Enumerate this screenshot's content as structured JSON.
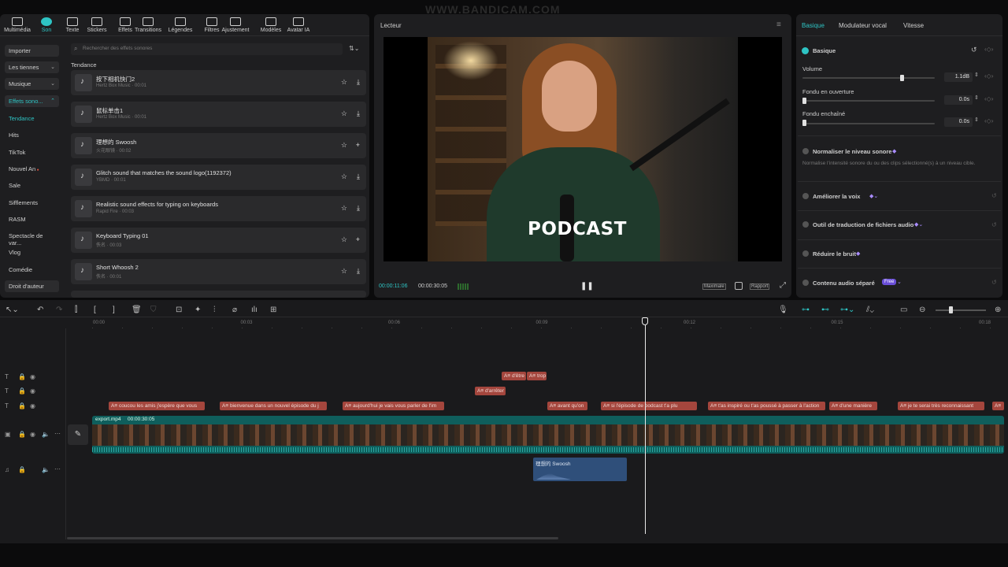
{
  "top_tabs": [
    {
      "label": "Multimédia",
      "icon": "media-icon"
    },
    {
      "label": "Son",
      "icon": "audio-icon"
    },
    {
      "label": "Texte",
      "icon": "text-icon"
    },
    {
      "label": "Stickers",
      "icon": "sticker-icon"
    },
    {
      "label": "Effets",
      "icon": "sparkle-icon"
    },
    {
      "label": "Transitions",
      "icon": "transition-icon"
    },
    {
      "label": "Légendes",
      "icon": "captions-icon"
    },
    {
      "label": "Filtres",
      "icon": "filter-icon"
    },
    {
      "label": "Ajustement",
      "icon": "adjust-icon"
    },
    {
      "label": "Modèles",
      "icon": "template-icon"
    },
    {
      "label": "Avatar IA",
      "icon": "avatar-icon"
    }
  ],
  "watermark": "WWW.BANDICAM.COM",
  "left_nav": {
    "importer": "Importer",
    "les_tiennes": "Les tiennes",
    "musique": "Musique",
    "effets_sonores": "Effets sono...",
    "items": [
      "Tendance",
      "Hits",
      "TikTok",
      "Nouvel An",
      "Sale",
      "Sifflements",
      "RASM",
      "Spectacle de var...",
      "Vlog",
      "Comédie",
      "Droit d'auteur"
    ]
  },
  "search": {
    "placeholder": "Rechercher des effets sonores"
  },
  "section_title": "Tendance",
  "sounds": [
    {
      "title": "按下相机快门2",
      "meta": "Hertz Box Music · 00:01",
      "action": "download"
    },
    {
      "title": "鼠标单击1",
      "meta": "Hertz Box Music · 00:01",
      "action": "download"
    },
    {
      "title": "理想的 Swoosh",
      "meta": "火花眼镜 · 00:02",
      "action": "add"
    },
    {
      "title": "Glitch sound that matches the sound logo(1192372)",
      "meta": "YBMD · 00:01",
      "action": "download"
    },
    {
      "title": "Realistic sound effects for typing on keyboards",
      "meta": "Rapid Fire · 00:03",
      "action": "download"
    },
    {
      "title": "Keyboard Typing 01",
      "meta": "佚名 · 00:03",
      "action": "add"
    },
    {
      "title": "Short Whoosh 2",
      "meta": "佚名 · 00:01",
      "action": "download"
    }
  ],
  "player": {
    "title": "Lecteur",
    "overlay_text": "PODCAST",
    "current_time": "00:00:11:06",
    "total_time": "00:00:30:05",
    "maximize": "Maximale",
    "ratio": "Rapport"
  },
  "right_tabs": [
    "Basique",
    "Modulateur vocal",
    "Vitesse"
  ],
  "basic": {
    "section": "Basique",
    "volume_label": "Volume",
    "volume_value": "1.1dB",
    "volume_level": 0.75,
    "fade_in_label": "Fondu en ouverture",
    "fade_in_value": "0.0s",
    "fade_out_label": "Fondu enchaîné",
    "fade_out_value": "0.0s",
    "normalize_label": "Normaliser le niveau sonore",
    "normalize_desc": "Normalise l'intensité sonore du ou des clips sélectionné(s) à un niveau cible.",
    "enhance_label": "Améliorer la voix",
    "translate_label": "Outil de traduction de fichiers audio",
    "noise_label": "Réduire le bruit",
    "separate_label": "Contenu audio séparé",
    "separate_badge": "Free"
  },
  "timeline": {
    "ticks": [
      "00:00",
      "00:03",
      "00:06",
      "00:09",
      "00:12",
      "00:15",
      "00:18"
    ],
    "video_clip": {
      "name": "export.mp4",
      "duration": "00:00:30:05"
    },
    "audio_clip": "理想的 Swoosh",
    "subs_row1": [
      "d'être",
      "trop"
    ],
    "subs_row2": [
      "d'arrêter"
    ],
    "subs_row3": [
      "coucou les amis j'espère que vous",
      "bienvenue dans un nouvel épisode du j",
      "aujourd'hui je vais vous parler de l'im",
      "avant qu'on",
      "si l'épisode de podcast t'a plu",
      "t'as inspiré ou t'as poussé à passer à l'action",
      "d'une manière",
      "je te serai très reconnaissant",
      ""
    ]
  }
}
